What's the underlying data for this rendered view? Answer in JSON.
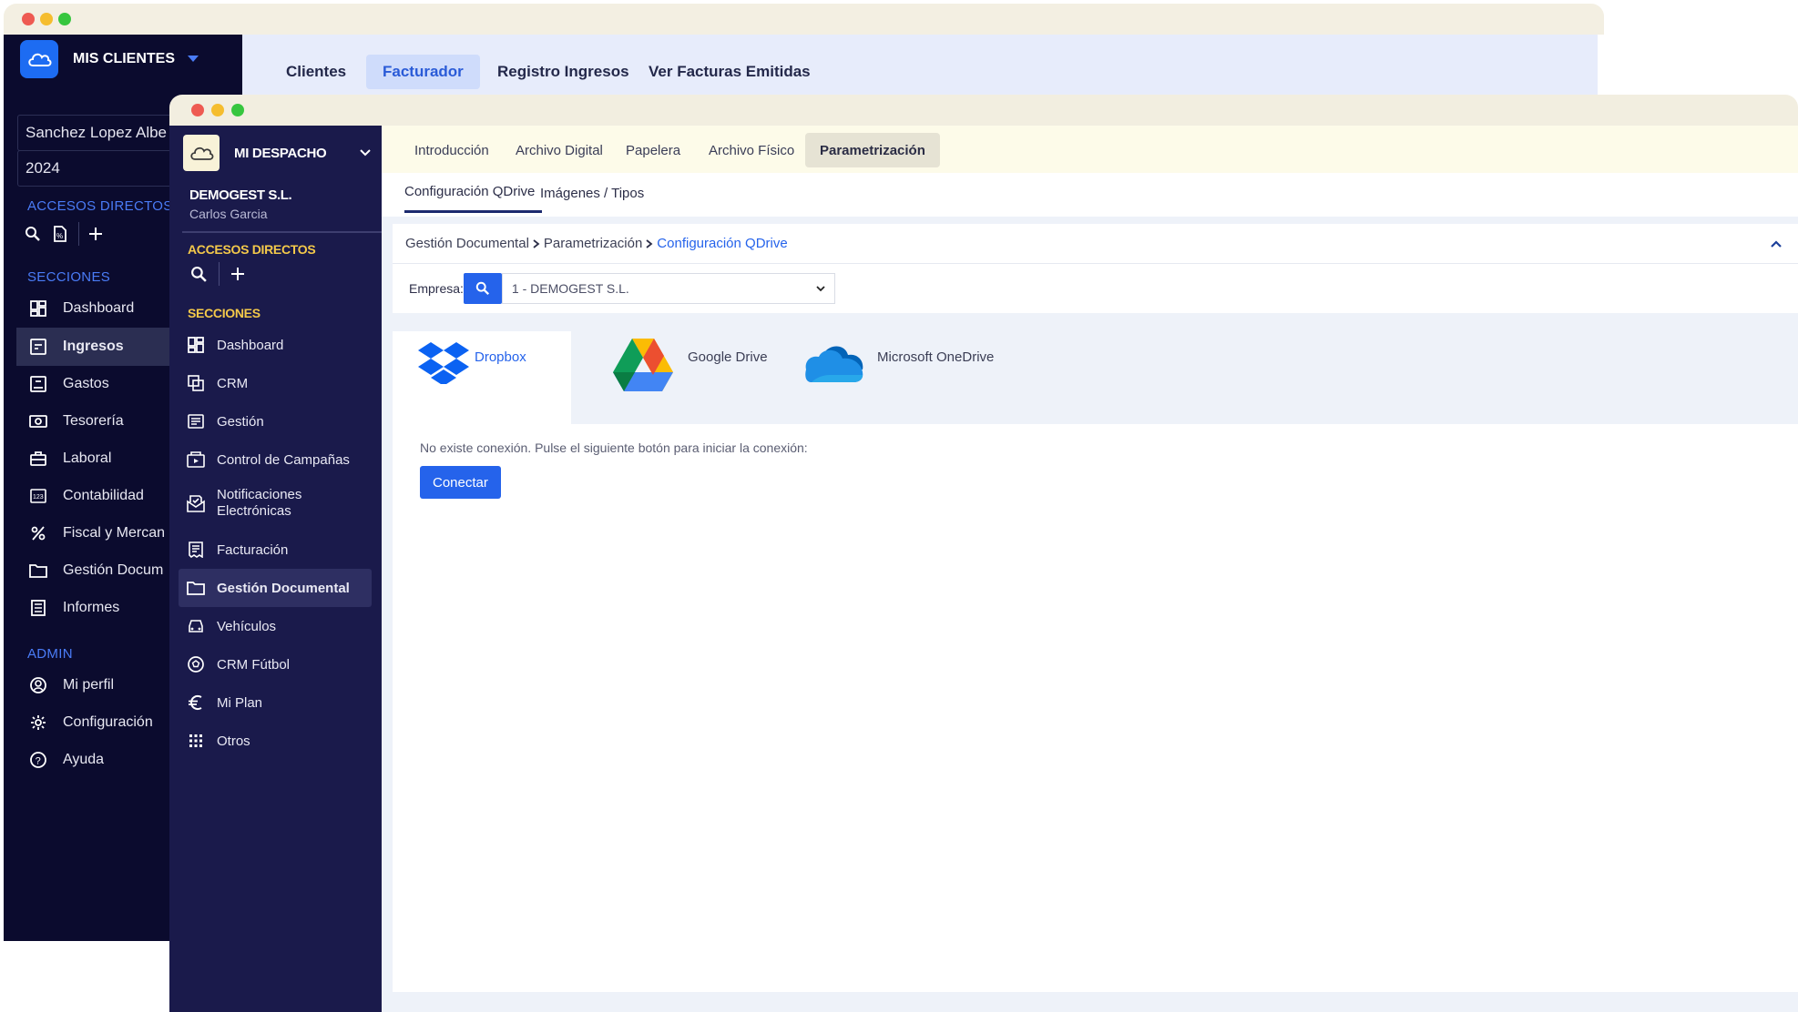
{
  "back_window": {
    "brand": "MIS CLIENTES",
    "tabs": [
      "Clientes",
      "Facturador",
      "Registro Ingresos",
      "Ver Facturas Emitidas"
    ],
    "active_tab": "Facturador",
    "client_field": "Sanchez Lopez Albe",
    "year_field": "2024",
    "section_accesos": "ACCESOS DIRECTOS",
    "section_secciones": "SECCIONES",
    "section_admin": "ADMIN",
    "nav": [
      {
        "label": "Dashboard",
        "icon": "dashboard-icon"
      },
      {
        "label": "Ingresos",
        "icon": "income-icon"
      },
      {
        "label": "Gastos",
        "icon": "expenses-icon"
      },
      {
        "label": "Tesorería",
        "icon": "treasury-icon"
      },
      {
        "label": "Laboral",
        "icon": "briefcase-icon"
      },
      {
        "label": "Contabilidad",
        "icon": "accounting-icon"
      },
      {
        "label": "Fiscal y Mercan",
        "icon": "percent-icon"
      },
      {
        "label": "Gestión Docum",
        "icon": "folder-icon"
      },
      {
        "label": "Informes",
        "icon": "reports-icon"
      }
    ],
    "active_nav": "Ingresos",
    "admin": [
      {
        "label": "Mi perfil",
        "icon": "profile-icon"
      },
      {
        "label": "Configuración",
        "icon": "gear-icon"
      },
      {
        "label": "Ayuda",
        "icon": "help-icon"
      }
    ]
  },
  "front_window": {
    "brand": "MI DESPACHO",
    "company": "DEMOGEST S.L.",
    "user": "Carlos Garcia",
    "section_accesos": "ACCESOS DIRECTOS",
    "section_secciones": "SECCIONES",
    "nav": [
      {
        "label": "Dashboard",
        "icon": "dashboard-icon"
      },
      {
        "label": "CRM",
        "icon": "crm-icon"
      },
      {
        "label": "Gestión",
        "icon": "gestion-icon"
      },
      {
        "label": "Control de Campañas",
        "icon": "campaign-icon"
      },
      {
        "label": "Notificaciones Electrónicas",
        "icon": "notifications-icon"
      },
      {
        "label": "Facturación",
        "icon": "invoice-icon"
      },
      {
        "label": "Gestión Documental",
        "icon": "folder-icon"
      },
      {
        "label": "Vehículos",
        "icon": "car-icon"
      },
      {
        "label": "CRM Fútbol",
        "icon": "football-icon"
      },
      {
        "label": "Mi Plan",
        "icon": "euro-icon"
      },
      {
        "label": "Otros",
        "icon": "grid-icon"
      }
    ],
    "active_nav": "Gestión Documental",
    "top_tabs": [
      "Introducción",
      "Archivo Digital",
      "Papelera",
      "Archivo Físico",
      "Parametrización"
    ],
    "active_top_tab": "Parametrización",
    "sub_tabs": [
      "Configuración QDrive",
      "Imágenes / Tipos"
    ],
    "active_sub_tab": "Configuración QDrive",
    "breadcrumb": {
      "level1": "Gestión Documental",
      "level2": "Parametrización",
      "current": "Configuración QDrive"
    },
    "empresa_label": "Empresa:",
    "empresa_value": "1 - DEMOGEST S.L.",
    "providers": [
      "Dropbox",
      "Google Drive",
      "Microsoft OneDrive"
    ],
    "active_provider": "Dropbox",
    "status_message": "No existe conexión. Pulse el siguiente botón para iniciar la conexión:",
    "connect_button": "Conectar"
  },
  "colors": {
    "back_sidebar": "#0b0b2e",
    "front_sidebar": "#1a1a4b",
    "accent_blue": "#2563eb",
    "section_yellow": "#f4c94a",
    "section_blue": "#4a7cf7"
  }
}
